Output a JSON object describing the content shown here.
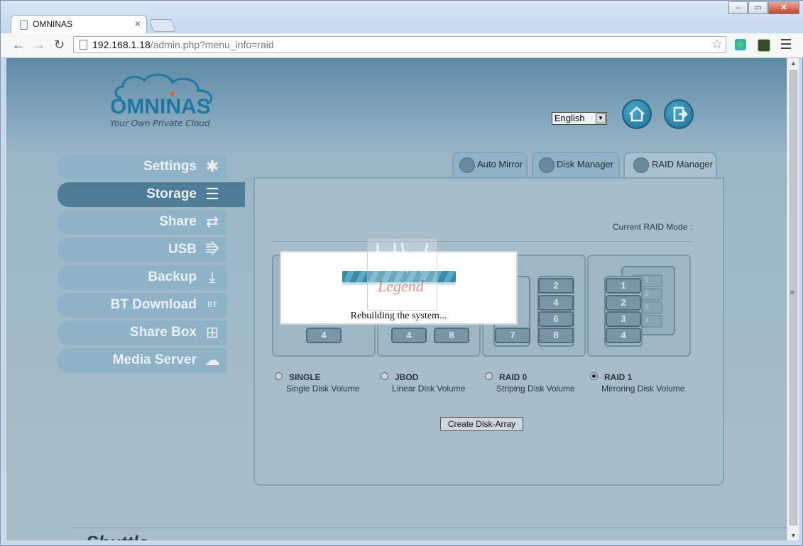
{
  "browser": {
    "tab_title": "OMNINAS",
    "tab_close": "×",
    "url_host": "192.168.1.18",
    "url_path": "/admin.php?menu_info=raid",
    "star": "☆",
    "window_buttons": {
      "minimize": "–",
      "restore": "▭",
      "close": "✕"
    }
  },
  "header": {
    "logo_text": "OMNINAS",
    "logo_tagline": "Your Own Private Cloud",
    "language": "English"
  },
  "sidebar": {
    "items": [
      {
        "label": "Settings",
        "icon": "✱"
      },
      {
        "label": "Storage",
        "icon": "☰"
      },
      {
        "label": "Share",
        "icon": "⇄"
      },
      {
        "label": "USB",
        "icon": "⭆"
      },
      {
        "label": "Backup",
        "icon": "⤓"
      },
      {
        "label": "BT Download",
        "icon": "BT"
      },
      {
        "label": "Share Box",
        "icon": "⊞"
      },
      {
        "label": "Media Server",
        "icon": "☁"
      }
    ]
  },
  "tabs": [
    {
      "label": "Auto Mirror"
    },
    {
      "label": "Disk Manager"
    },
    {
      "label": "RAID Manager"
    }
  ],
  "raid": {
    "current_mode_label": "Current RAID Mode :",
    "options": [
      {
        "name": "SINGLE",
        "desc": "Single Disk Volume",
        "selected": false
      },
      {
        "name": "JBOD",
        "desc": "Linear Disk Volume",
        "selected": false
      },
      {
        "name": "RAID 0",
        "desc": "Striping Disk Volume",
        "selected": false
      },
      {
        "name": "RAID 1",
        "desc": "Mirroring Disk Volume",
        "selected": true
      }
    ],
    "disk_labels": {
      "single": [
        "4"
      ],
      "jbod": [
        "4",
        "8"
      ],
      "raid0": [
        "2",
        "4",
        "6",
        "7",
        "8"
      ],
      "raid1": [
        "1",
        "2",
        "3",
        "4"
      ]
    },
    "create_button": "Create Disk-Array"
  },
  "modal": {
    "message": "Rebuilding the system...",
    "watermark": "Legend"
  },
  "footer": {
    "brand": "Shuttle"
  },
  "colors": {
    "accent": "#1f6f91",
    "sidebar_active": "#4f7c96",
    "sidebar": "#8fb2c7"
  }
}
